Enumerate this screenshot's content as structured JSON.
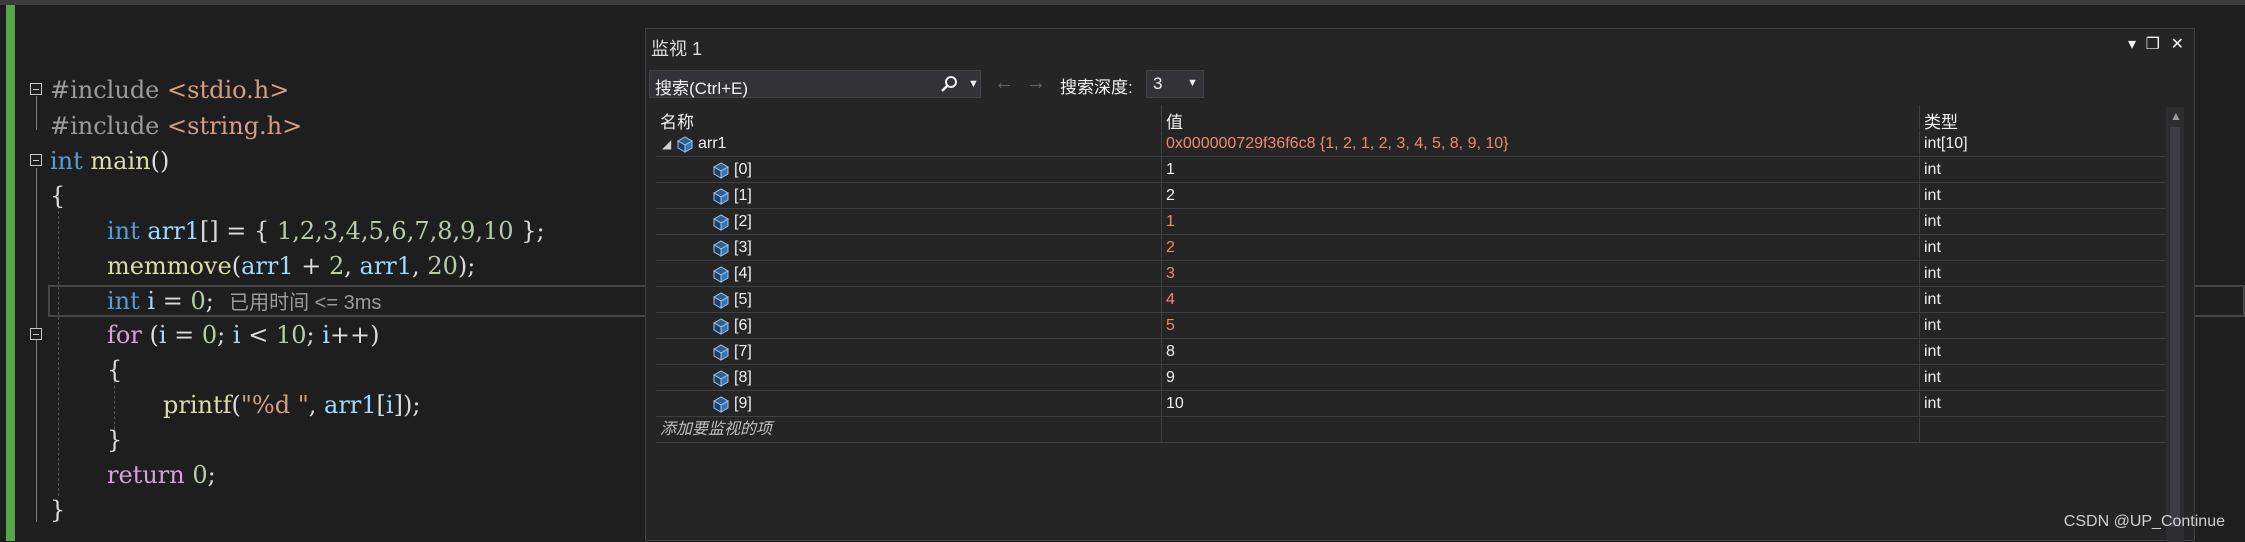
{
  "editor": {
    "lines": {
      "l1_pp": "#include ",
      "l1_inc": "<stdio.h>",
      "l2_pp": "#include ",
      "l2_inc": "<string.h>",
      "l3_kw": "int",
      "l3_fn": " main",
      "l3_rest": "()",
      "l4": "{",
      "l5_kw": "int",
      "l5_var": " arr1",
      "l5_rest1": "[] = { ",
      "l5_nums": "1,2,3,4,5,6,7,8,9,10",
      "l5_rest2": " };",
      "l6_fn": "memmove",
      "l6_rest1": "(",
      "l6_var1": "arr1",
      "l6_rest2": " + ",
      "l6_num1": "2",
      "l6_rest3": ", ",
      "l6_var2": "arr1",
      "l6_rest4": ", ",
      "l6_num2": "20",
      "l6_rest5": ");",
      "l7_kw": "int",
      "l7_var": " i",
      "l7_rest": " = ",
      "l7_num": "0",
      "l7_end": ";",
      "l7_elapsed": "已用时间 <= 3ms",
      "l8_kw": "for",
      "l8_rest1": " (",
      "l8_var1": "i",
      "l8_rest2": " = ",
      "l8_num1": "0",
      "l8_rest3": "; ",
      "l8_var2": "i",
      "l8_rest4": " < ",
      "l8_num2": "10",
      "l8_rest5": "; ",
      "l8_var3": "i",
      "l8_rest6": "++)",
      "l9": "{",
      "l10_fn": "printf",
      "l10_rest1": "(",
      "l10_str": "\"%d \"",
      "l10_rest2": ", ",
      "l10_var": "arr1",
      "l10_rest3": "[",
      "l10_var2": "i",
      "l10_rest4": "]);",
      "l11": "}",
      "l12_kw": "return",
      "l12_rest": " ",
      "l12_num": "0",
      "l12_end": ";",
      "l13": "}"
    }
  },
  "watch": {
    "title": "监视 1",
    "window_buttons": {
      "dropdown": "▾",
      "maximize": "❐",
      "close": "✕"
    },
    "search_placeholder": "搜索(Ctrl+E)",
    "search_icon": "search-icon",
    "back_arrow": "←",
    "forward_arrow": "→",
    "depth_label": "搜索深度:",
    "depth_value": "3",
    "columns": {
      "name": "名称",
      "value": "值",
      "type": "类型"
    },
    "rows": [
      {
        "name": "arr1",
        "value": "0x000000729f36f6c8 {1, 2, 1, 2, 3, 4, 5, 8, 9, 10}",
        "type": "int[10]",
        "expander": "◢",
        "changed": true
      },
      {
        "name": "[0]",
        "value": "1",
        "type": "int",
        "changed": false
      },
      {
        "name": "[1]",
        "value": "2",
        "type": "int",
        "changed": false
      },
      {
        "name": "[2]",
        "value": "1",
        "type": "int",
        "changed": true
      },
      {
        "name": "[3]",
        "value": "2",
        "type": "int",
        "changed": true
      },
      {
        "name": "[4]",
        "value": "3",
        "type": "int",
        "changed": true
      },
      {
        "name": "[5]",
        "value": "4",
        "type": "int",
        "changed": true
      },
      {
        "name": "[6]",
        "value": "5",
        "type": "int",
        "changed": true
      },
      {
        "name": "[7]",
        "value": "8",
        "type": "int",
        "changed": false
      },
      {
        "name": "[8]",
        "value": "9",
        "type": "int",
        "changed": false
      },
      {
        "name": "[9]",
        "value": "10",
        "type": "int",
        "changed": false
      }
    ],
    "add_item": "添加要监视的项"
  },
  "watermark": "CSDN @UP_Continue",
  "colors": {
    "changed": "#f48771",
    "keyword": "#569cd6",
    "function": "#dcdcaa",
    "variable": "#9cdcfe",
    "number": "#b5cea8",
    "string": "#d69d85"
  }
}
